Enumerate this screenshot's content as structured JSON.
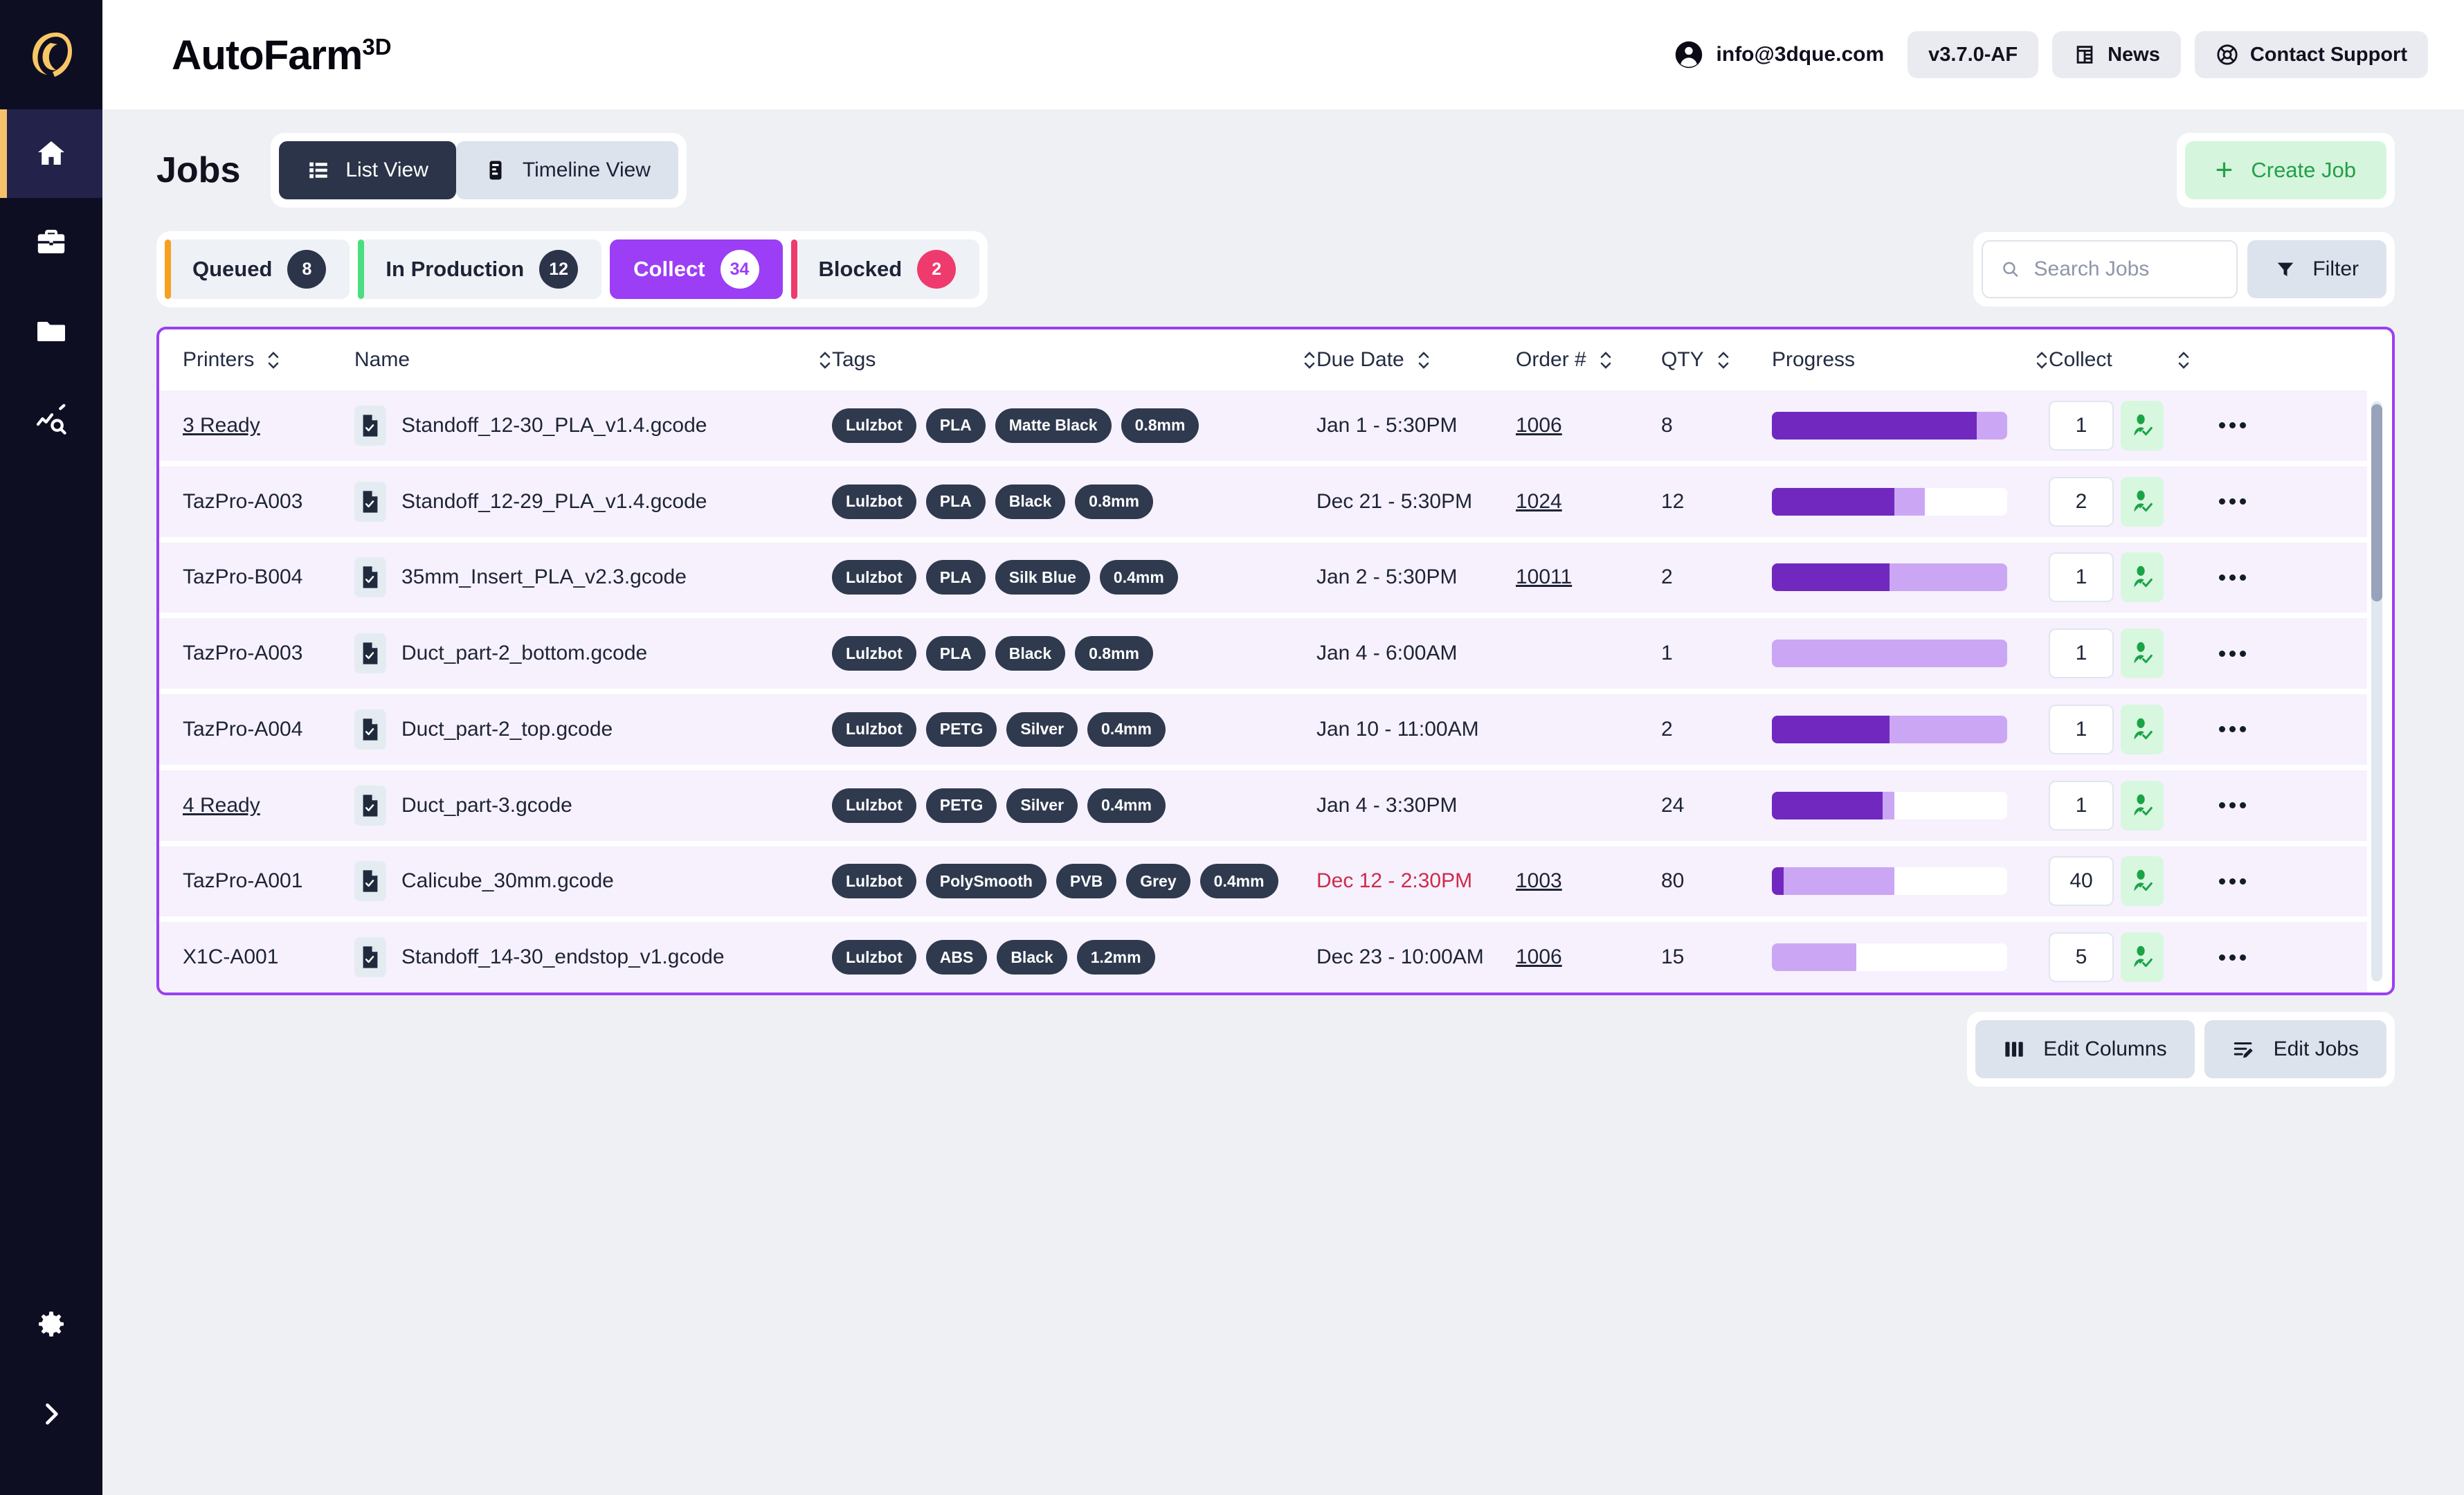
{
  "brand": {
    "name": "AutoFarm",
    "sup": "3D"
  },
  "topbar": {
    "account_email": "info@3dque.com",
    "version": "v3.7.0-AF",
    "news": "News",
    "contact_support": "Contact Support"
  },
  "sidebar": {
    "items": [
      {
        "icon": "home-icon",
        "active": true
      },
      {
        "icon": "briefcase-icon",
        "active": false
      },
      {
        "icon": "folder-icon",
        "active": false
      },
      {
        "icon": "analytics-search-icon",
        "active": false
      }
    ],
    "bottom": [
      {
        "icon": "gear-icon"
      },
      {
        "icon": "chevron-right-icon"
      }
    ]
  },
  "page": {
    "title": "Jobs",
    "views": [
      {
        "label": "List View",
        "icon": "list-icon",
        "active": true
      },
      {
        "label": "Timeline View",
        "icon": "timeline-icon",
        "active": false
      }
    ],
    "create_job": "Create Job"
  },
  "tabs": [
    {
      "label": "Queued",
      "count": "8",
      "accent": "#f6a020",
      "selected": false
    },
    {
      "label": "In Production",
      "count": "12",
      "accent": "#4ade80",
      "selected": false
    },
    {
      "label": "Collect",
      "count": "34",
      "accent": "#9b3ef5",
      "selected": true
    },
    {
      "label": "Blocked",
      "count": "2",
      "accent": "#ef3a6e",
      "selected": false
    }
  ],
  "search": {
    "placeholder": "Search Jobs",
    "value": ""
  },
  "filter": {
    "label": "Filter"
  },
  "table": {
    "columns": [
      {
        "label": "Printers",
        "sortable": true
      },
      {
        "label": "Name",
        "sortable": true
      },
      {
        "label": "Tags",
        "sortable": true
      },
      {
        "label": "Due Date",
        "sortable": true
      },
      {
        "label": "Order #",
        "sortable": true
      },
      {
        "label": "QTY",
        "sortable": true
      },
      {
        "label": "Progress",
        "sortable": true
      },
      {
        "label": "Collect",
        "sortable": true
      }
    ],
    "rows": [
      {
        "printer": "3 Ready",
        "printer_link": true,
        "name": "Standoff_12-30_PLA_v1.4.gcode",
        "tags": [
          "Lulzbot",
          "PLA",
          "Matte Black",
          "0.8mm"
        ],
        "due": "Jan 1 - 5:30PM",
        "overdue": false,
        "order": "1006",
        "qty": "8",
        "progress": {
          "dark": 87,
          "light": 13
        },
        "collect": "1"
      },
      {
        "printer": "TazPro-A003",
        "printer_link": false,
        "name": "Standoff_12-29_PLA_v1.4.gcode",
        "tags": [
          "Lulzbot",
          "PLA",
          "Black",
          "0.8mm"
        ],
        "due": "Dec 21 - 5:30PM",
        "overdue": false,
        "order": "1024",
        "qty": "12",
        "progress": {
          "dark": 52,
          "light": 13
        },
        "collect": "2"
      },
      {
        "printer": "TazPro-B004",
        "printer_link": false,
        "name": "35mm_Insert_PLA_v2.3.gcode",
        "tags": [
          "Lulzbot",
          "PLA",
          "Silk Blue",
          "0.4mm"
        ],
        "due": "Jan 2 - 5:30PM",
        "overdue": false,
        "order": "10011",
        "qty": "2",
        "progress": {
          "dark": 50,
          "light": 50
        },
        "collect": "1"
      },
      {
        "printer": "TazPro-A003",
        "printer_link": false,
        "name": "Duct_part-2_bottom.gcode",
        "tags": [
          "Lulzbot",
          "PLA",
          "Black",
          "0.8mm"
        ],
        "due": "Jan 4 - 6:00AM",
        "overdue": false,
        "order": "",
        "qty": "1",
        "progress": {
          "dark": 0,
          "light": 100
        },
        "collect": "1"
      },
      {
        "printer": "TazPro-A004",
        "printer_link": false,
        "name": "Duct_part-2_top.gcode",
        "tags": [
          "Lulzbot",
          "PETG",
          "Silver",
          "0.4mm"
        ],
        "due": "Jan 10 - 11:00AM",
        "overdue": false,
        "order": "",
        "qty": "2",
        "progress": {
          "dark": 50,
          "light": 50
        },
        "collect": "1"
      },
      {
        "printer": "4 Ready",
        "printer_link": true,
        "name": "Duct_part-3.gcode",
        "tags": [
          "Lulzbot",
          "PETG",
          "Silver",
          "0.4mm"
        ],
        "due": "Jan 4 - 3:30PM",
        "overdue": false,
        "order": "",
        "qty": "24",
        "progress": {
          "dark": 47,
          "light": 5
        },
        "collect": "1"
      },
      {
        "printer": "TazPro-A001",
        "printer_link": false,
        "name": "Calicube_30mm.gcode",
        "tags": [
          "Lulzbot",
          "PolySmooth",
          "PVB",
          "Grey",
          "0.4mm"
        ],
        "due": "Dec 12 - 2:30PM",
        "overdue": true,
        "order": "1003",
        "qty": "80",
        "progress": {
          "dark": 5,
          "light": 47
        },
        "collect": "40"
      },
      {
        "printer": "X1C-A001",
        "printer_link": false,
        "name": "Standoff_14-30_endstop_v1.gcode",
        "tags": [
          "Lulzbot",
          "ABS",
          "Black",
          "1.2mm"
        ],
        "due": "Dec 23 - 10:00AM",
        "overdue": false,
        "order": "1006",
        "qty": "15",
        "progress": {
          "dark": 0,
          "light": 36
        },
        "collect": "5"
      }
    ]
  },
  "footer": {
    "edit_columns": "Edit Columns",
    "edit_jobs": "Edit Jobs"
  },
  "colors": {
    "accent_purple": "#9b3ef5",
    "progress_dark": "#7128bf",
    "progress_light": "#cba6f5",
    "overdue_red": "#cc2b4e",
    "create_green": "#22a04a",
    "sidebar_dark": "#0e0e23",
    "sidebar_active_bar": "#f6c16a"
  }
}
